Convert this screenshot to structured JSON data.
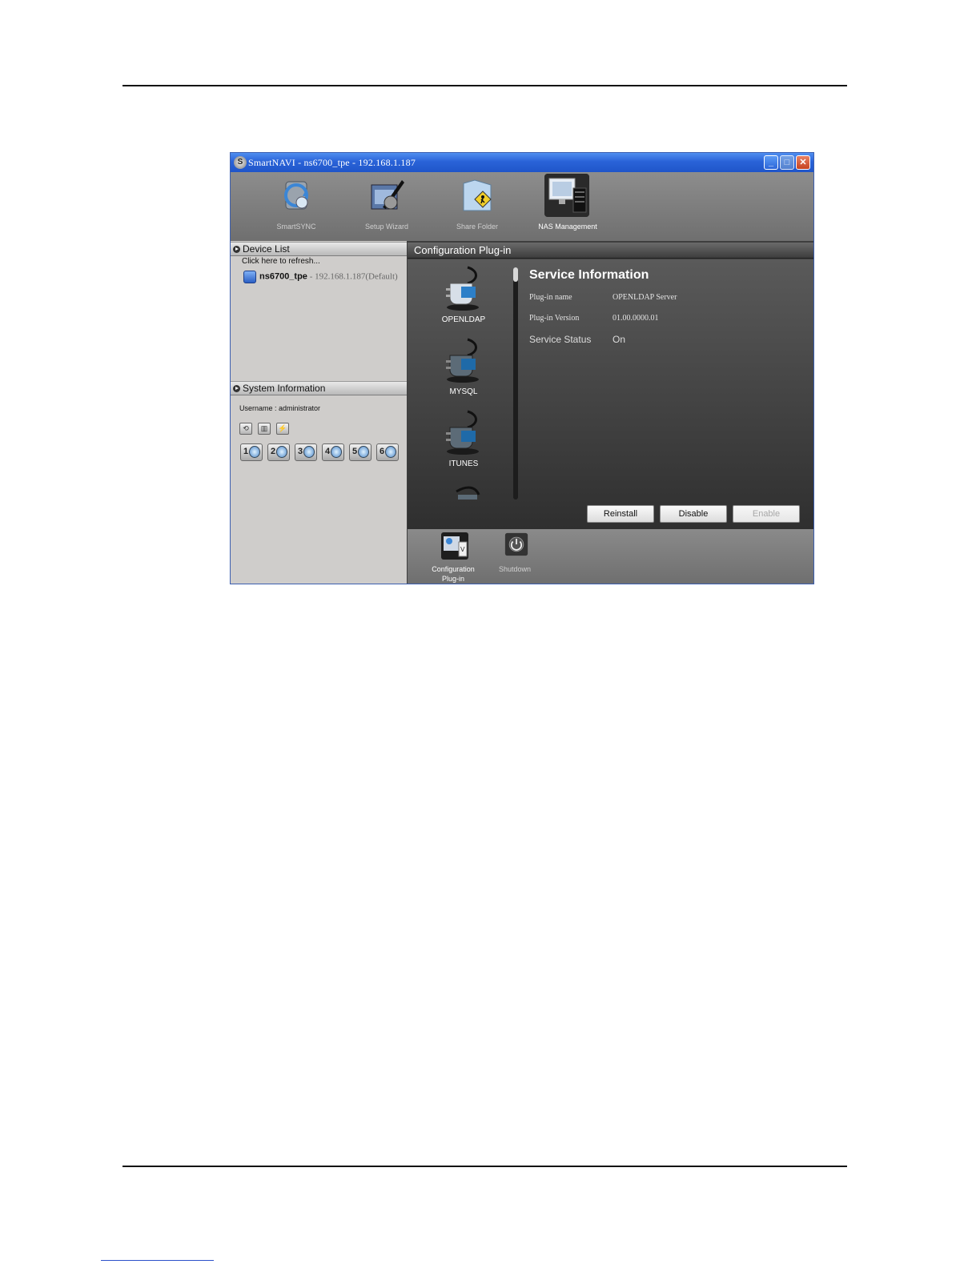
{
  "window": {
    "title": "SmartNAVI - ns6700_tpe - 192.168.1.187",
    "app_icon": "S",
    "controls": {
      "minimize": "_",
      "maximize": "□",
      "close": "✕"
    }
  },
  "toolbar": {
    "items": [
      {
        "label": "SmartSYNC",
        "icon": "sync-disk-icon"
      },
      {
        "label": "Setup Wizard",
        "icon": "wizard-tools-icon"
      },
      {
        "label": "Share Folder",
        "icon": "share-folder-icon"
      },
      {
        "label": "NAS Management",
        "icon": "nas-management-icon"
      }
    ]
  },
  "left": {
    "device_list": {
      "header": "Device List",
      "refresh": "Click here to refresh...",
      "device_name": "ns6700_tpe",
      "device_ip": " - 192.168.1.187(Default)"
    },
    "system_info": {
      "header": "System Information",
      "username": "Username : administrator",
      "disks": [
        "1",
        "2",
        "3",
        "4",
        "5",
        "6"
      ]
    }
  },
  "main": {
    "header": "Configuration Plug-in",
    "plugins": [
      "OPENLDAP",
      "MYSQL",
      "ITUNES"
    ],
    "service": {
      "title": "Service Information",
      "name_label": "Plug-in name",
      "name_value": "OPENLDAP Server",
      "version_label": "Plug-in Version",
      "version_value": "01.00.0000.01",
      "status_label": "Service Status",
      "status_value": "On"
    },
    "buttons": {
      "reinstall": "Reinstall",
      "disable": "Disable",
      "enable": "Enable"
    }
  },
  "bottom": {
    "items": [
      {
        "label": "Configuration Plug-in"
      },
      {
        "label": "Shutdown"
      }
    ]
  },
  "colors": {
    "titlebar": "#2a63d8",
    "panel_dark": "#3e3e3e",
    "panel_light": "#cfcdcb"
  }
}
